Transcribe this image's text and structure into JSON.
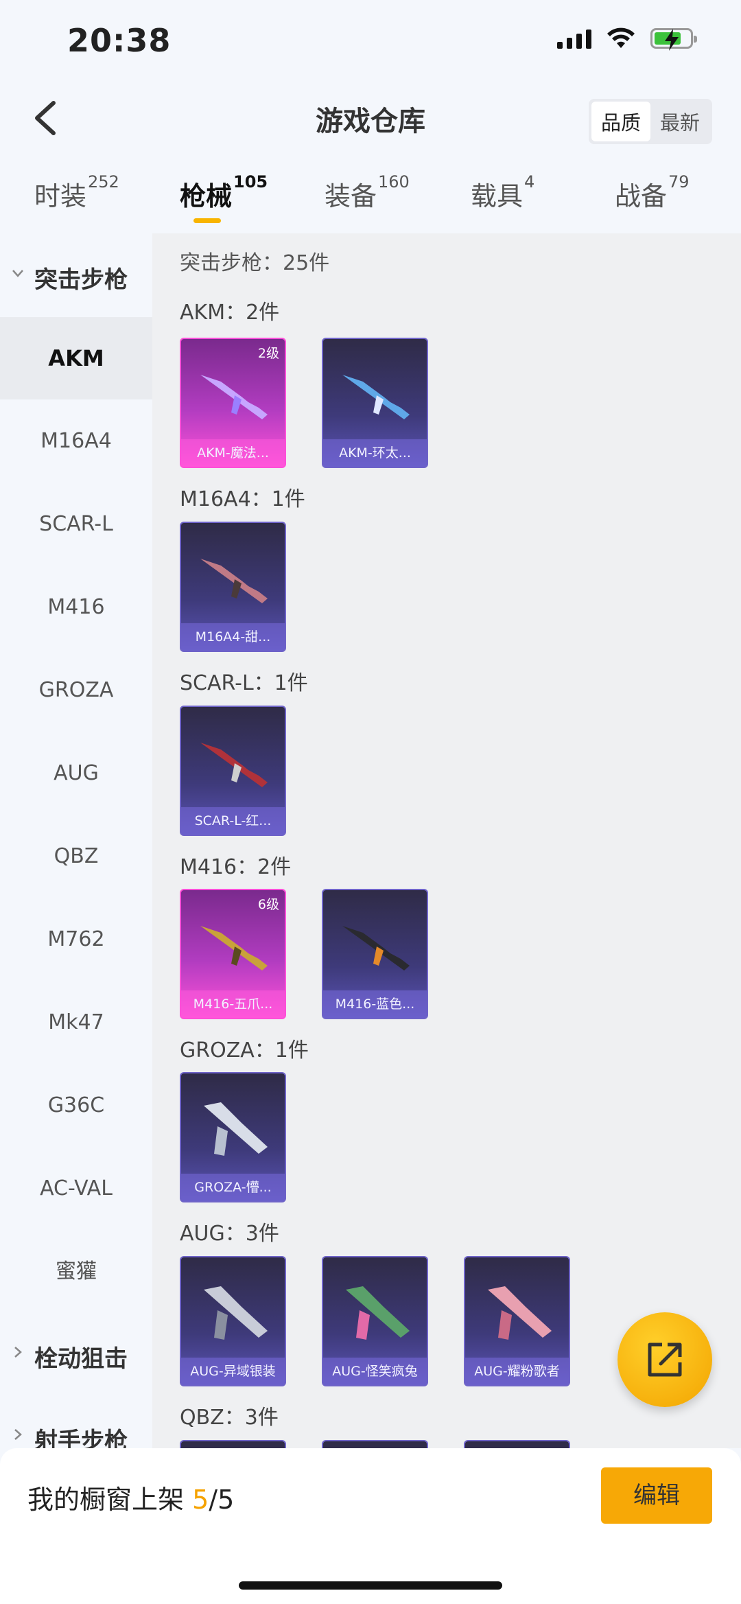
{
  "status_bar": {
    "time": "20:38"
  },
  "header": {
    "title": "游戏仓库",
    "sort_options": [
      "品质",
      "最新"
    ]
  },
  "tabs": [
    {
      "label": "时装",
      "count": "252"
    },
    {
      "label": "枪械",
      "count": "105"
    },
    {
      "label": "装备",
      "count": "160"
    },
    {
      "label": "载具",
      "count": "4"
    },
    {
      "label": "战备",
      "count": "79"
    }
  ],
  "sidebar": {
    "expanded_category": "突击步枪",
    "items": [
      "AKM",
      "M16A4",
      "SCAR-L",
      "M416",
      "GROZA",
      "AUG",
      "QBZ",
      "M762",
      "Mk47",
      "G36C",
      "AC-VAL",
      "蜜獾"
    ],
    "collapsed_categories": [
      "栓动狙击",
      "射手步枪"
    ]
  },
  "content": {
    "heading": "突击步枪：25件",
    "groups": [
      {
        "label": "AKM：2件",
        "items": [
          {
            "name": "AKM-魔法...",
            "level": "2级",
            "quality": "pink"
          },
          {
            "name": "AKM-环太...",
            "level": "",
            "quality": "purple"
          }
        ]
      },
      {
        "label": "M16A4：1件",
        "items": [
          {
            "name": "M16A4-甜...",
            "level": "",
            "quality": "purple"
          }
        ]
      },
      {
        "label": "SCAR-L：1件",
        "items": [
          {
            "name": "SCAR-L-红...",
            "level": "",
            "quality": "purple"
          }
        ]
      },
      {
        "label": "M416：2件",
        "items": [
          {
            "name": "M416-五爪...",
            "level": "6级",
            "quality": "pink"
          },
          {
            "name": "M416-蓝色...",
            "level": "",
            "quality": "purple"
          }
        ]
      },
      {
        "label": "GROZA：1件",
        "items": [
          {
            "name": "GROZA-懵...",
            "level": "",
            "quality": "purple"
          }
        ]
      },
      {
        "label": "AUG：3件",
        "items": [
          {
            "name": "AUG-异域银装",
            "level": "",
            "quality": "purple"
          },
          {
            "name": "AUG-怪笑疯兔",
            "level": "",
            "quality": "purple"
          },
          {
            "name": "AUG-耀粉歌者",
            "level": "",
            "quality": "purple"
          }
        ]
      },
      {
        "label": "QBZ：3件",
        "items": []
      }
    ]
  },
  "bottom_bar": {
    "shelf_label": "我的橱窗上架",
    "shelf_used": "5",
    "shelf_total": "/5",
    "edit_label": "编辑"
  },
  "colors": {
    "accent": "#f7a806",
    "pink_quality": "#ff4fd8",
    "purple_quality": "#6e63c8"
  }
}
